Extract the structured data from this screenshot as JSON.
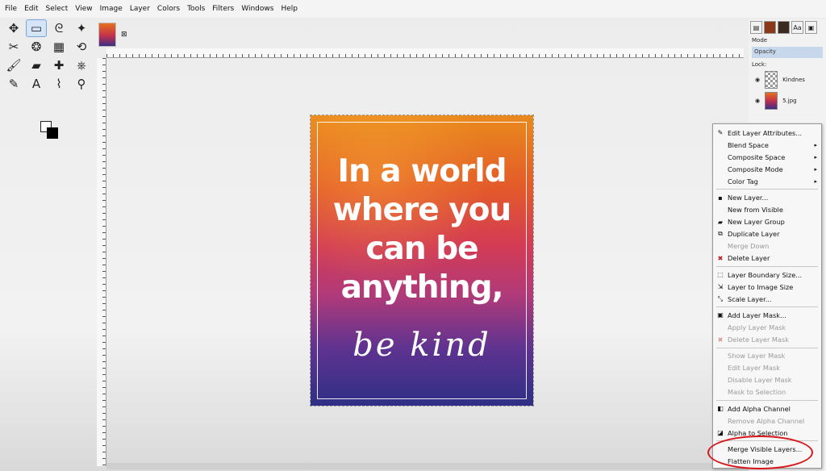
{
  "menubar": [
    "File",
    "Edit",
    "Select",
    "View",
    "Image",
    "Layer",
    "Colors",
    "Tools",
    "Filters",
    "Windows",
    "Help"
  ],
  "toolbox": {
    "tools": [
      "move-icon",
      "rect-select-icon",
      "lasso-icon",
      "fuzzy-select-icon",
      "crop-icon",
      "warp-icon",
      "cage-icon",
      "transform-icon",
      "paintbrush-icon",
      "eraser-icon",
      "heal-icon",
      "clone-icon",
      "path-icon",
      "text-icon",
      "color-picker-icon",
      "zoom-icon"
    ],
    "fg_color": "#ffffff",
    "bg_color": "#000000"
  },
  "dock": {
    "mode_label": "Mode",
    "opacity_label": "Opacity",
    "lock_label": "Lock:",
    "layers": [
      {
        "name": "Kindnes"
      },
      {
        "name": "5.jpg"
      }
    ]
  },
  "poster": {
    "lines": [
      "In a world",
      "where you",
      "can be",
      "anything,"
    ],
    "script": "be kind"
  },
  "context_menu": [
    {
      "label": "Edit Layer Attributes...",
      "icon": "edit-icon",
      "enabled": true
    },
    {
      "label": "Blend Space",
      "enabled": true,
      "submenu": true
    },
    {
      "label": "Composite Space",
      "enabled": true,
      "submenu": true
    },
    {
      "label": "Composite Mode",
      "enabled": true,
      "submenu": true
    },
    {
      "label": "Color Tag",
      "enabled": true,
      "submenu": true
    },
    {
      "sep": true
    },
    {
      "label": "New Layer...",
      "icon": "new-layer-icon",
      "enabled": true
    },
    {
      "label": "New from Visible",
      "enabled": true
    },
    {
      "label": "New Layer Group",
      "icon": "folder-icon",
      "enabled": true
    },
    {
      "label": "Duplicate Layer",
      "icon": "duplicate-icon",
      "enabled": true
    },
    {
      "label": "Merge Down",
      "enabled": false
    },
    {
      "label": "Delete Layer",
      "icon": "delete-icon",
      "enabled": true
    },
    {
      "sep": true
    },
    {
      "label": "Layer Boundary Size...",
      "icon": "boundary-icon",
      "enabled": true
    },
    {
      "label": "Layer to Image Size",
      "icon": "fit-icon",
      "enabled": true
    },
    {
      "label": "Scale Layer...",
      "icon": "scale-icon",
      "enabled": true
    },
    {
      "sep": true
    },
    {
      "label": "Add Layer Mask...",
      "icon": "mask-icon",
      "enabled": true
    },
    {
      "label": "Apply Layer Mask",
      "enabled": false
    },
    {
      "label": "Delete Layer Mask",
      "icon": "delete-icon",
      "enabled": false
    },
    {
      "sep": true
    },
    {
      "label": "Show Layer Mask",
      "enabled": false
    },
    {
      "label": "Edit Layer Mask",
      "enabled": false
    },
    {
      "label": "Disable Layer Mask",
      "enabled": false
    },
    {
      "label": "Mask to Selection",
      "enabled": false
    },
    {
      "sep": true
    },
    {
      "label": "Add Alpha Channel",
      "icon": "alpha-icon",
      "enabled": true
    },
    {
      "label": "Remove Alpha Channel",
      "enabled": false
    },
    {
      "label": "Alpha to Selection",
      "icon": "alpha-select-icon",
      "enabled": true
    },
    {
      "sep": true
    },
    {
      "label": "Merge Visible Layers...",
      "enabled": true
    },
    {
      "label": "Flatten Image",
      "enabled": true
    }
  ],
  "highlight_color": "#d8151a"
}
